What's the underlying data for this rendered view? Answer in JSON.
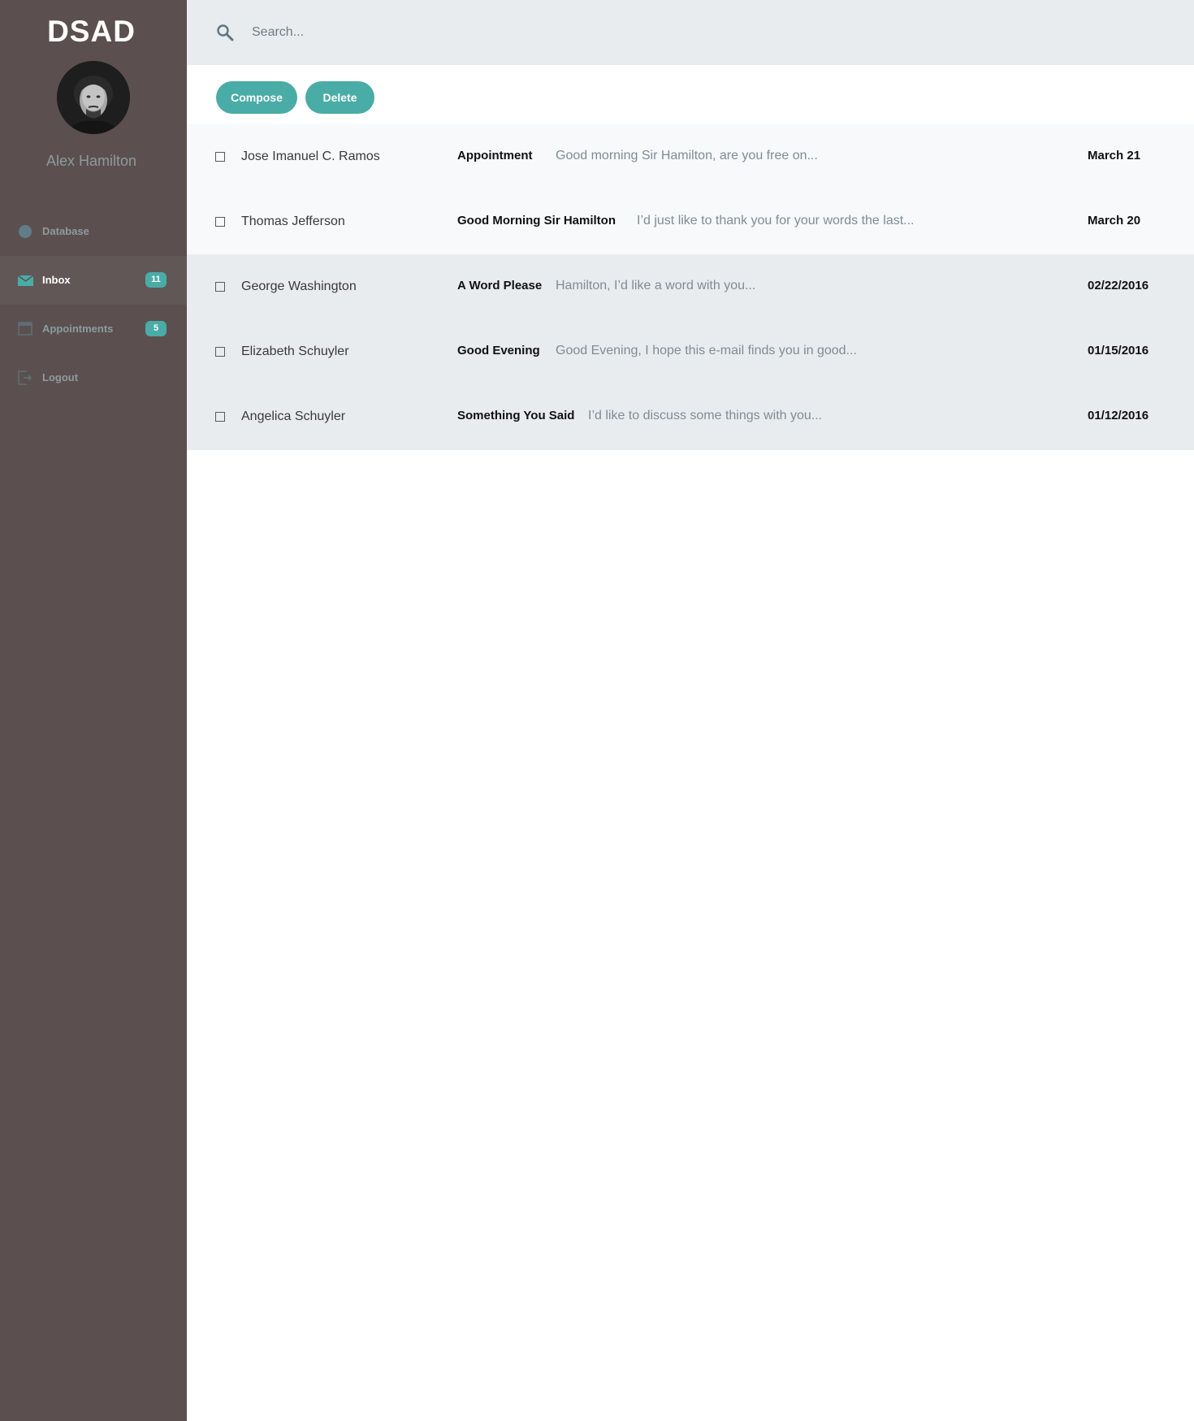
{
  "sidebar": {
    "brand": "DSAD",
    "user_name": "Alex Hamilton",
    "items": [
      {
        "label": "Database",
        "icon": "database-icon",
        "badge": ""
      },
      {
        "label": "Inbox",
        "icon": "mail-icon",
        "badge": "11",
        "active": true
      },
      {
        "label": "Appointments",
        "icon": "calendar-icon",
        "badge": "5"
      },
      {
        "label": "Logout",
        "icon": "logout-icon",
        "badge": ""
      }
    ]
  },
  "search": {
    "placeholder": "Search...",
    "value": ""
  },
  "toolbar": {
    "compose_label": "Compose",
    "delete_label": "Delete"
  },
  "messages": [
    {
      "sender": "Jose Imanuel C. Ramos",
      "subject": "Appointment",
      "preview": "Good morning Sir Hamilton, are you free on...",
      "date": "March 21"
    },
    {
      "sender": "Thomas Jefferson",
      "subject": "Good Morning Sir Hamilton",
      "preview": "I’d just like to thank you for  your words the last...",
      "date": "March 20"
    },
    {
      "sender": "George Washington",
      "subject": "A Word Please",
      "preview": "Hamilton, I’d like a word with you...",
      "date": "02/22/2016"
    },
    {
      "sender": "Elizabeth Schuyler",
      "subject": "Good Evening",
      "preview": "Good Evening, I hope this e-mail finds you in good...",
      "date": "01/15/2016"
    },
    {
      "sender": "Angelica Schuyler",
      "subject": "Something You Said",
      "preview": "I’d like to discuss some things with you...",
      "date": "01/12/2016"
    }
  ],
  "colors": {
    "sidebar_bg": "#5b504f",
    "sidebar_active": "#625757",
    "accent": "#4aaca6",
    "muted_text": "#8d9aa0",
    "search_bg": "#e8ecef"
  }
}
